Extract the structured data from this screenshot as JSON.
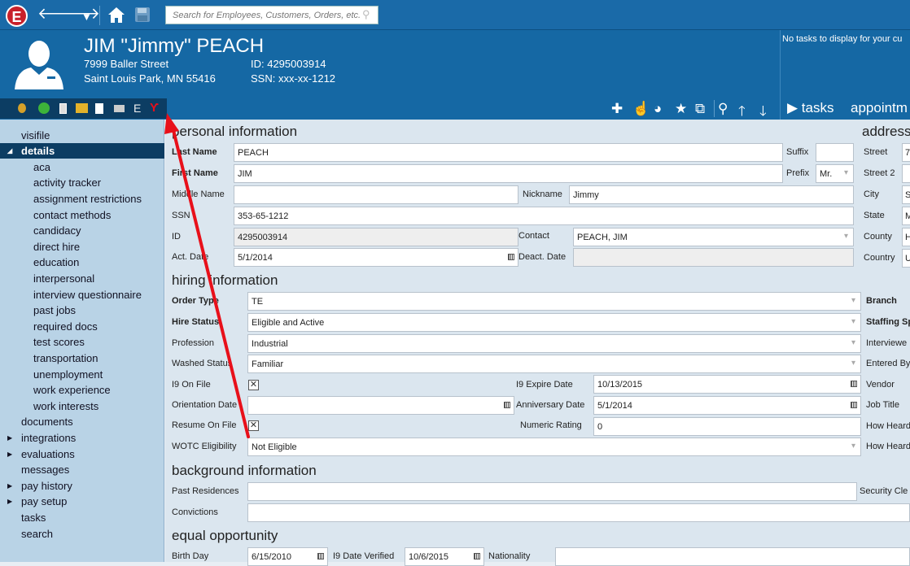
{
  "search": {
    "placeholder": "Search for Employees, Customers, Orders, etc."
  },
  "person": {
    "name": "JIM \"Jimmy\" PEACH",
    "street": "7999 Baller Street",
    "city_state_zip": "Saint Louis Park, MN 55416",
    "id_line": "ID: 4295003914",
    "ssn_line": "SSN: xxx-xx-1212"
  },
  "tasks": {
    "empty_message": "No tasks to display for your cu",
    "tab_tasks": "tasks",
    "tab_appointments": "appointm"
  },
  "sidebar": {
    "items": [
      "visifile",
      "details",
      "aca",
      "activity tracker",
      "assignment restrictions",
      "contact methods",
      "candidacy",
      "direct hire",
      "education",
      "interpersonal",
      "interview questionnaire",
      "past jobs",
      "required docs",
      "test scores",
      "transportation",
      "unemployment",
      "work experience",
      "work interests",
      "documents",
      "integrations",
      "evaluations",
      "messages",
      "pay history",
      "pay setup",
      "tasks",
      "search"
    ]
  },
  "sections": {
    "personal": "personal information",
    "address": "address",
    "hiring": "hiring information",
    "background": "background information",
    "equal": "equal opportunity"
  },
  "personal": {
    "last_name_label": "Last Name",
    "last_name": "PEACH",
    "suffix_label": "Suffix",
    "first_name_label": "First Name",
    "first_name": "JIM",
    "prefix_label": "Prefix",
    "prefix": "Mr.",
    "middle_name_label": "Middle Name",
    "nickname_label": "Nickname",
    "nickname": "Jimmy",
    "ssn_label": "SSN",
    "ssn": "353-65-1212",
    "id_label": "ID",
    "id": "4295003914",
    "contact_label": "Contact",
    "contact": "PEACH, JIM",
    "act_date_label": "Act. Date",
    "act_date": "5/1/2014",
    "deact_date_label": "Deact. Date"
  },
  "address": {
    "street_label": "Street",
    "street_value": "7",
    "street2_label": "Street 2",
    "city_label": "City",
    "city_value": "S",
    "state_label": "State",
    "state_value": "M",
    "county_label": "County",
    "county_value": "H",
    "country_label": "Country",
    "country_value": "U"
  },
  "hiring": {
    "order_type_label": "Order Type",
    "order_type": "TE",
    "branch_label": "Branch",
    "hire_status_label": "Hire Status",
    "hire_status": "Eligible and Active",
    "staffing_label": "Staffing Sp",
    "profession_label": "Profession",
    "profession": "Industrial",
    "interviewer_label": "Interviewe",
    "washed_label": "Washed Status",
    "washed": "Familiar",
    "entered_label": "Entered By",
    "i9_label": "I9 On File",
    "i9_expire_label": "I9 Expire Date",
    "i9_expire": "10/13/2015",
    "vendor_label": "Vendor",
    "orientation_label": "Orientation Date",
    "anniversary_label": "Anniversary Date",
    "anniversary": "5/1/2014",
    "job_title_label": "Job Title",
    "resume_label": "Resume On File",
    "numeric_label": "Numeric Rating",
    "numeric": "0",
    "how_heard1_label": "How Heard",
    "wotc_label": "WOTC Eligibility",
    "wotc": "Not Eligible",
    "how_heard2_label": "How Heard"
  },
  "background": {
    "past_res_label": "Past Residences",
    "security_label": "Security Cle",
    "convictions_label": "Convictions"
  },
  "equal": {
    "birth_label": "Birth Day",
    "birth": "6/15/2010",
    "i9_verified_label": "I9 Date Verified",
    "i9_verified": "10/6/2015",
    "nationality_label": "Nationality"
  },
  "colors": {
    "header": "#1568a4",
    "sidebar": "#b9d3e6",
    "selected": "#0c3d63",
    "annotation": "#e8101a"
  }
}
